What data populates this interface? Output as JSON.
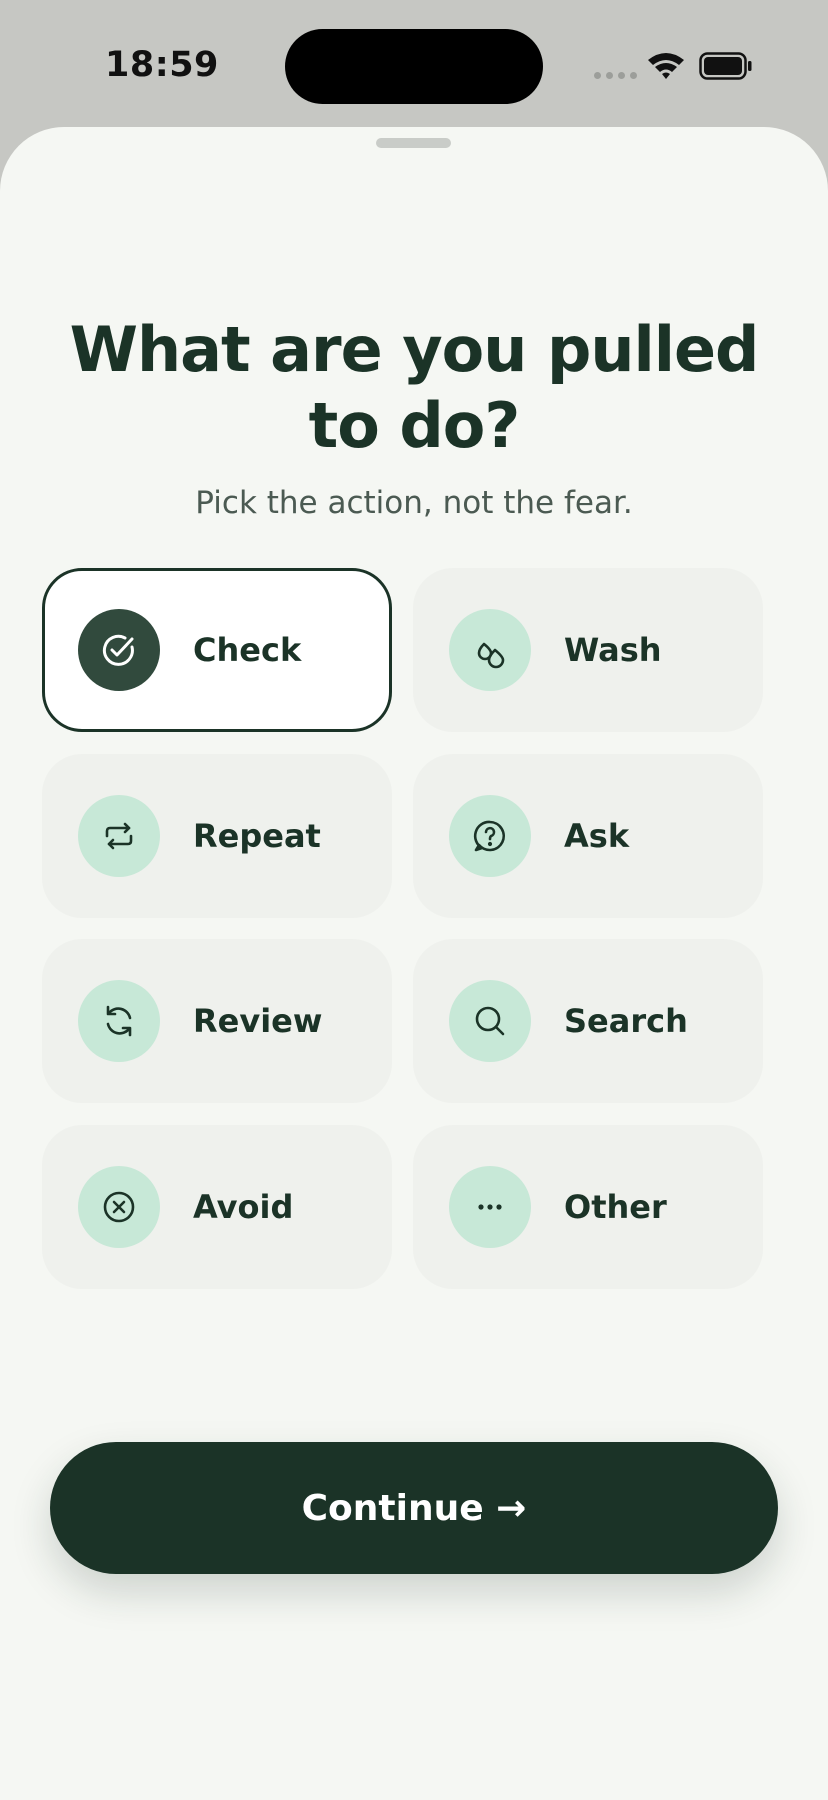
{
  "status_bar": {
    "time": "18:59"
  },
  "header": {
    "title": "What are you pulled to do?",
    "subtitle": "Pick the action, not the fear."
  },
  "options": [
    {
      "label": "Check",
      "icon": "check-circle-icon",
      "selected": true
    },
    {
      "label": "Wash",
      "icon": "droplets-icon",
      "selected": false
    },
    {
      "label": "Repeat",
      "icon": "repeat-icon",
      "selected": false
    },
    {
      "label": "Ask",
      "icon": "question-bubble-icon",
      "selected": false
    },
    {
      "label": "Review",
      "icon": "refresh-icon",
      "selected": false
    },
    {
      "label": "Search",
      "icon": "search-icon",
      "selected": false
    },
    {
      "label": "Avoid",
      "icon": "x-circle-icon",
      "selected": false
    },
    {
      "label": "Other",
      "icon": "more-icon",
      "selected": false
    }
  ],
  "footer": {
    "continue_label": "Continue →"
  },
  "colors": {
    "accent_dark": "#1b3327",
    "icon_background": "#c7e8d7",
    "card_background": "#eff1ed",
    "sheet_background": "#f5f7f3"
  }
}
